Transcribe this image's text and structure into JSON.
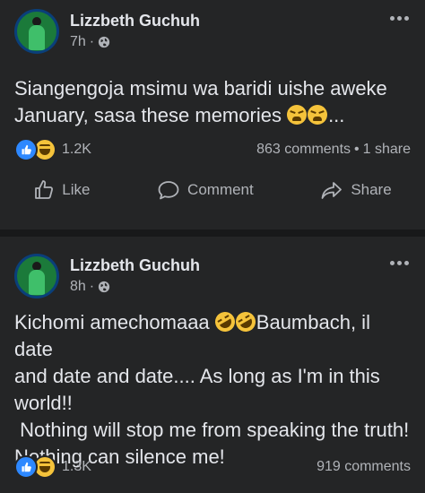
{
  "posts": [
    {
      "author": "Lizzbeth Guchuh",
      "time": "7h",
      "text_line1": "Siangengoja msimu wa baridi uishe aweke",
      "text_line2_pre": "January, sasa these memories ",
      "text_line2_post": "...",
      "reaction_count": "1.2K",
      "comments": "863 comments",
      "stat_separator": "•",
      "shares": "1 share",
      "actions": {
        "like": "Like",
        "comment": "Comment",
        "share": "Share"
      }
    },
    {
      "author": "Lizzbeth Guchuh",
      "time": "8h",
      "text_line1_pre": "Kichomi amechomaaa ",
      "text_line1_post": "Baumbach, il date",
      "text_rest": "and date and date.... As long as I'm in this\nworld!!\n Nothing will stop me from speaking the truth!\nNothing can silence me!",
      "reaction_count": "1.3K",
      "comments": "919 comments"
    }
  ],
  "colors": {
    "background": "#18191a",
    "card": "#242526",
    "text_primary": "#e4e6eb",
    "text_secondary": "#b0b3b8",
    "like_blue": "#2d88ff"
  },
  "icons": {
    "privacy": "globe-icon",
    "more": "more-options-icon",
    "like": "thumbs-up-icon",
    "comment": "comment-bubble-icon",
    "share": "share-arrow-icon"
  }
}
